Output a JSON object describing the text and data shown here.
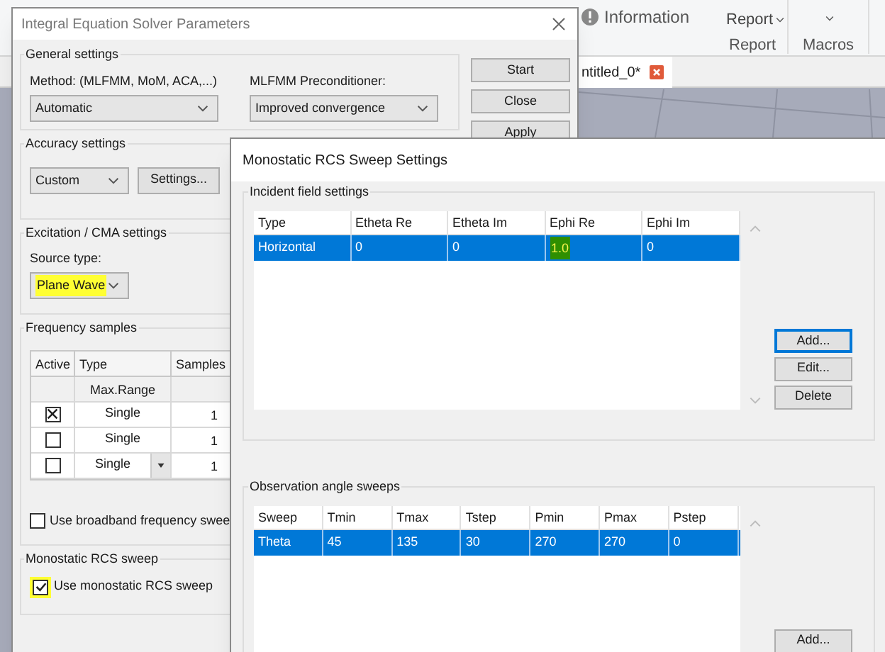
{
  "background_app": {
    "ribbon": {
      "information": "Information",
      "report_button": "Report",
      "report_group": "Report",
      "macros_group": "Macros"
    },
    "document_tab": {
      "label": "ntitled_0*"
    }
  },
  "solver_dialog": {
    "title": "Integral Equation Solver Parameters",
    "general_settings": {
      "title": "General settings",
      "method": {
        "label": "Method: (MLFMM, MoM, ACA,...)",
        "value": "Automatic"
      },
      "preconditioner": {
        "label": "MLFMM Preconditioner:",
        "value": "Improved convergence"
      }
    },
    "buttons": [
      "Start",
      "Close",
      "Apply"
    ],
    "accuracy_settings": {
      "title": "Accuracy settings",
      "value": "Custom",
      "button": "Settings..."
    },
    "excitation": {
      "title": "Excitation / CMA settings",
      "source_type": {
        "label": "Source type:",
        "value": "Plane Wave",
        "highlighted": true
      }
    },
    "frequency_samples": {
      "title": "Frequency samples",
      "columns": [
        "Active",
        "Type",
        "Samples"
      ],
      "rows": [
        {
          "kind": "range",
          "type": "Max.Range"
        },
        {
          "kind": "sample",
          "checked": true,
          "type": "Single",
          "samples": "1",
          "dropdown": false
        },
        {
          "kind": "sample",
          "checked": false,
          "type": "Single",
          "samples": "1",
          "dropdown": false
        },
        {
          "kind": "sample",
          "checked": false,
          "type": "Single",
          "samples": "1",
          "dropdown": true
        }
      ],
      "broadband": {
        "label": "Use broadband frequency swee",
        "checked": false
      }
    },
    "monostatic": {
      "title": "Monostatic RCS sweep",
      "checkbox": {
        "label": "Use monostatic RCS sweep",
        "checked": true,
        "highlighted": true
      }
    }
  },
  "rcs_dialog": {
    "title": "Monostatic RCS Sweep Settings",
    "incident": {
      "title": "Incident field settings",
      "columns": [
        "Type",
        "Etheta Re",
        "Etheta Im",
        "Ephi Re",
        "Ephi Im"
      ],
      "rows": [
        {
          "selected": true,
          "cells": [
            {
              "text": "Horizontal",
              "highlighted": false
            },
            {
              "text": "0",
              "highlighted": false
            },
            {
              "text": "0",
              "highlighted": false
            },
            {
              "text": "1.0",
              "highlighted": true
            },
            {
              "text": "0",
              "highlighted": false
            }
          ]
        }
      ],
      "buttons": [
        {
          "label": "Add...",
          "focused": true
        },
        {
          "label": "Edit...",
          "focused": false
        },
        {
          "label": "Delete",
          "focused": false
        }
      ]
    },
    "observation": {
      "title": "Observation angle sweeps",
      "columns": [
        "Sweep",
        "Tmin",
        "Tmax",
        "Tstep",
        "Pmin",
        "Pmax",
        "Pstep"
      ],
      "rows": [
        {
          "selected": true,
          "cells": [
            "Theta",
            "45",
            "135",
            "30",
            "270",
            "270",
            "0"
          ]
        }
      ],
      "buttons": [
        {
          "label": "Add...",
          "focused": false
        }
      ]
    }
  }
}
